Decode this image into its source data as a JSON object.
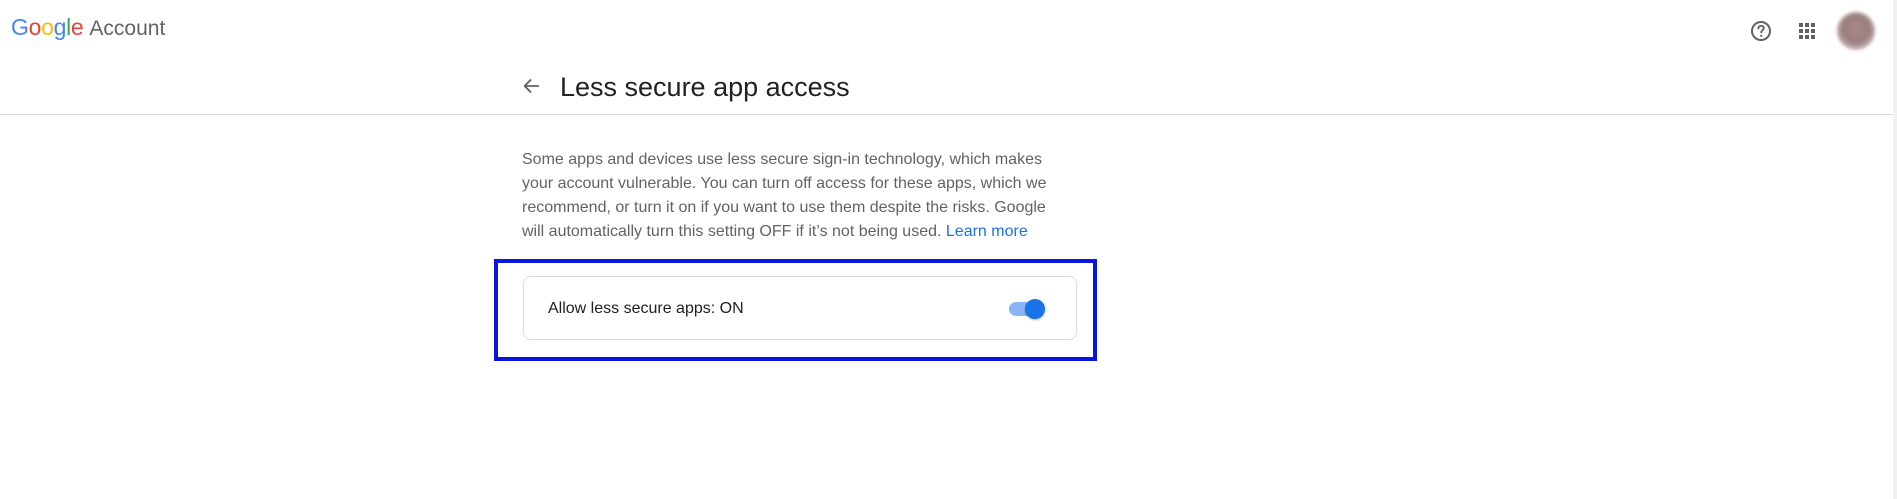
{
  "header": {
    "logo_google_letters": [
      "G",
      "o",
      "o",
      "g",
      "l",
      "e"
    ],
    "logo_google_colors": [
      "#4285F4",
      "#EA4335",
      "#FBBC05",
      "#4285F4",
      "#34A853",
      "#EA4335"
    ],
    "logo_account": "Account",
    "icons": [
      "help-icon",
      "apps-icon",
      "avatar"
    ]
  },
  "page": {
    "back_icon": "arrow-back-icon",
    "title": "Less secure app access"
  },
  "content": {
    "description": "Some apps and devices use less secure sign-in technology, which makes your account vulnerable. You can turn off access for these apps, which we recommend, or turn it on if you want to use them despite the risks. Google will automatically turn this setting OFF if it’s not being used.",
    "learn_more": "Learn more",
    "setting_label": "Allow less secure apps: ON",
    "toggle_state": "on"
  },
  "colors": {
    "accent": "#1a73e8",
    "toggle_track": "#8ab4f8",
    "highlight": "#0a14e0",
    "text_primary": "#202124",
    "text_secondary": "#5f6368"
  }
}
